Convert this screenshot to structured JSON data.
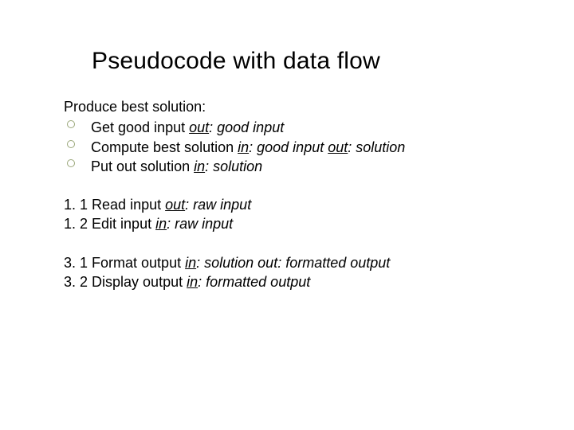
{
  "title": "Pseudocode with data flow",
  "intro": "Produce best solution:",
  "bullets": [
    {
      "prefix": "Get good input ",
      "kw1": "out",
      "after1": ":",
      "val1": " good input"
    },
    {
      "prefix": "Compute best solution ",
      "kw1": "in",
      "after1": ":",
      "val1": " good input ",
      "kw2": "out",
      "after2": ":",
      "val2": " solution"
    },
    {
      "prefix": "Put out solution ",
      "kw1": "in",
      "after1": ":",
      "val1": " solution"
    }
  ],
  "block1": [
    {
      "num": "1. 1 ",
      "name": "Read input ",
      "kw1": "out",
      "after1": ":",
      "val1": " raw input"
    },
    {
      "num": "1. 2 ",
      "name": "Edit input ",
      "kw1": "in",
      "after1": ":",
      "val1": " raw input"
    }
  ],
  "block2": [
    {
      "num": "3. 1 ",
      "name": "Format output ",
      "kw1": "in",
      "after1": ":",
      "val1": " solution out: formatted output"
    },
    {
      "num": "3. 2 ",
      "name": "Display output ",
      "kw1": "in",
      "after1": ":",
      "val1": " formatted output"
    }
  ]
}
